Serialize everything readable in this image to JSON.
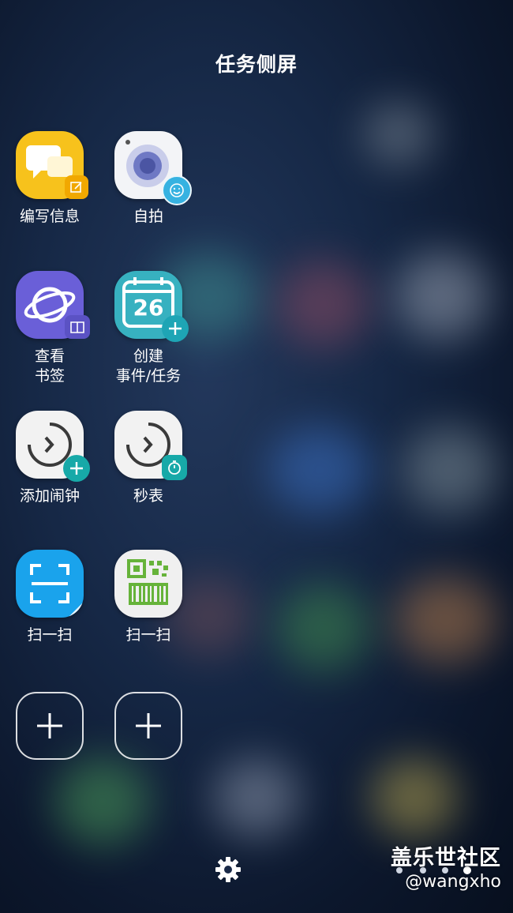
{
  "panel": {
    "title": "任务侧屏"
  },
  "tasks": [
    {
      "label": "编写信息"
    },
    {
      "label": "自拍"
    },
    {
      "label": "查看\n书签"
    },
    {
      "label": "创建\n事件/任务",
      "date": "26"
    },
    {
      "label": "添加闹钟"
    },
    {
      "label": "秒表"
    },
    {
      "label": "扫一扫"
    },
    {
      "label": "扫一扫"
    }
  ],
  "colors": {
    "messages": "#f7c21c",
    "messages_badge": "#f1a800",
    "camera": "#f3f4f7",
    "camera_lens": "#4b55a3",
    "camera_badge": "#36b2e1",
    "internet": "#6a5fd8",
    "calendar": "#37b1c0",
    "calendar_badge": "#1ea5b5",
    "clock_badge": "#17a9a8",
    "scan_blue": "#1aa3ec",
    "scan_green": "#66b33a"
  },
  "icons": [
    "message-icon",
    "camera-icon",
    "internet-icon",
    "calendar-icon",
    "alarm-icon",
    "stopwatch-icon",
    "scan-icon",
    "qr-scan-icon",
    "plus-icon",
    "gear-icon"
  ],
  "watermark": {
    "line1": "盖乐世社区",
    "line2": "@wangxho"
  }
}
